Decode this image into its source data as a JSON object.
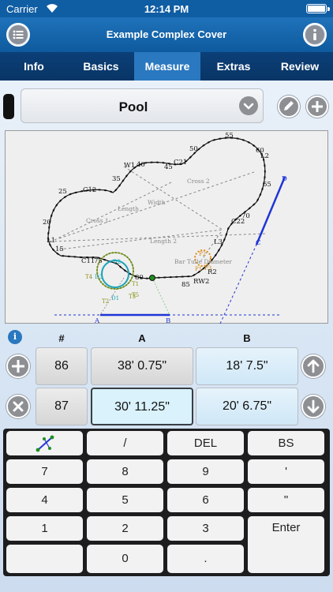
{
  "status_bar": {
    "carrier": "Carrier",
    "time": "12:14 PM"
  },
  "header": {
    "title": "Example Complex Cover",
    "menu_icon": "list-icon",
    "info_icon": "info-icon"
  },
  "tabs": [
    {
      "label": "Info",
      "active": false
    },
    {
      "label": "Basics",
      "active": false
    },
    {
      "label": "Measure",
      "active": true
    },
    {
      "label": "Extras",
      "active": false
    },
    {
      "label": "Review",
      "active": false
    }
  ],
  "selector": {
    "value": "Pool"
  },
  "diagram": {
    "numbers": [
      "55",
      "60",
      "50",
      "45",
      "40",
      "35",
      "25",
      "20",
      "15",
      "65",
      "70",
      "75",
      "80",
      "85"
    ],
    "points": [
      "L2",
      "C21",
      "W1",
      "C12",
      "L1",
      "C11",
      "C22",
      "L3",
      "R2",
      "RW2",
      "D",
      "C",
      "A",
      "B"
    ],
    "labels": [
      "Cross 2",
      "Width",
      "Length",
      "Cross 1",
      "Length 2",
      "Bar Tulle Diameter",
      "T1",
      "T2",
      "T3",
      "T4",
      "T5",
      "D1",
      "D2",
      "D3",
      "P1",
      "P2",
      "P3"
    ],
    "colors": {
      "outline": "#111111",
      "dimension": "#888888",
      "line_cd": "#1f35d6",
      "circle_green": "#708c1a",
      "circle_cyan": "#1ba3b8",
      "circle_orange": "#e08d19",
      "label_olive": "#8a8f1a",
      "label_orange": "#cc8a1e"
    }
  },
  "grid": {
    "headers": {
      "num": "#",
      "a": "A",
      "b": "B"
    },
    "rows": [
      {
        "num": "86",
        "a": "38' 0.75\"",
        "b": "18' 7.5\"",
        "selected": false
      },
      {
        "num": "87",
        "a": "30' 11.25\"",
        "b": "20' 6.75\"",
        "selected": true
      }
    ]
  },
  "keypad": {
    "row1": [
      "",
      "/",
      "DEL",
      "BS"
    ],
    "row2": [
      "7",
      "8",
      "9",
      "'"
    ],
    "row3": [
      "4",
      "5",
      "6",
      "\""
    ],
    "row4": [
      "1",
      "2",
      "3"
    ],
    "row5": [
      "",
      "0",
      "."
    ],
    "enter": "Enter"
  }
}
